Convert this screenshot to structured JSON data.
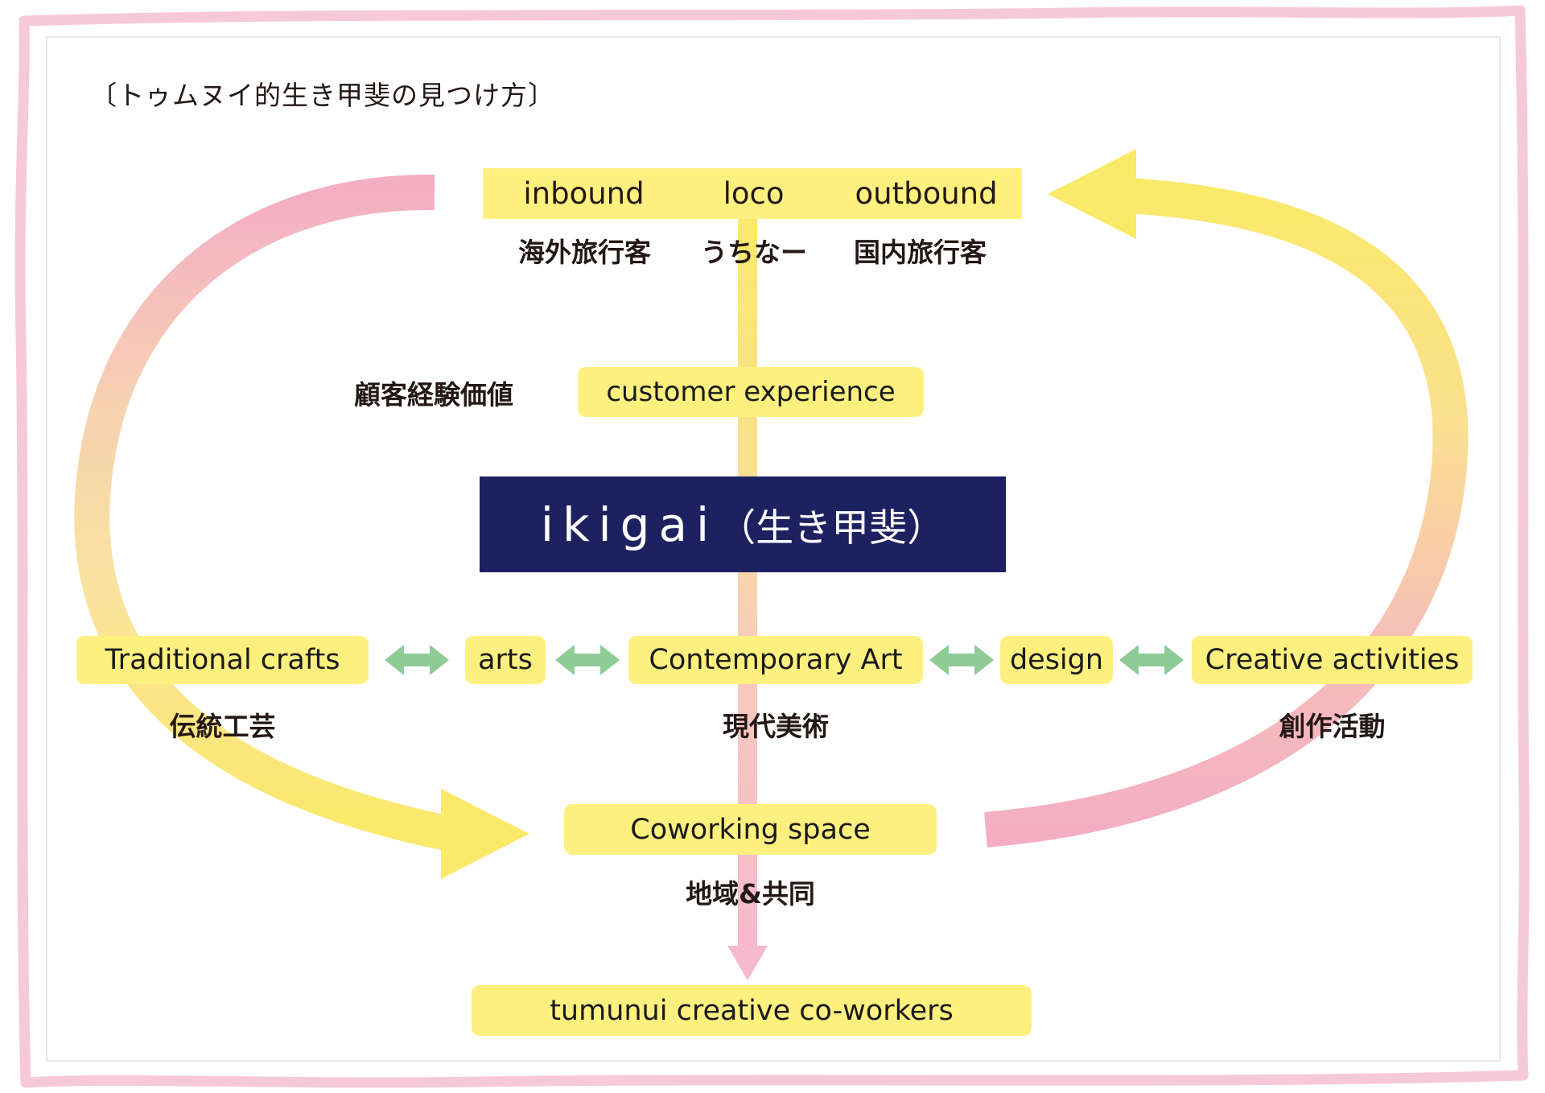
{
  "title": "〔トゥムヌイ的生き甲斐の見つけ方〕",
  "top_row": {
    "items": [
      {
        "en": "inbound",
        "jp": "海外旅行客"
      },
      {
        "en": "loco",
        "jp": "うちなー"
      },
      {
        "en": "outbound",
        "jp": "国内旅行客"
      }
    ]
  },
  "customer_experience": {
    "jp_label": "顧客経験価値",
    "en_label": "customer experience"
  },
  "center": {
    "roman": "ikigai",
    "kana": "（生き甲斐）"
  },
  "middle_row": {
    "nodes": [
      {
        "en": "Traditional  crafts",
        "jp": "伝統工芸"
      },
      {
        "en": "arts",
        "jp": ""
      },
      {
        "en": "Contemporary Art",
        "jp": "現代美術"
      },
      {
        "en": "design",
        "jp": ""
      },
      {
        "en": "Creative activities",
        "jp": "創作活動"
      }
    ],
    "connector": "double-arrow"
  },
  "coworking": {
    "en_label": "Coworking space",
    "jp_label": "地域&共同"
  },
  "bottom": {
    "label": "tumunui creative co-workers"
  },
  "colors": {
    "chip_yellow": "#fdf07f",
    "center_navy": "#1e2160",
    "arrow_green": "#8fcb95",
    "arrow_yellow": "#fbe96a",
    "arrow_pink": "#f3aec4",
    "frame_pink": "#f6c9d8",
    "text_dark": "#231815"
  }
}
